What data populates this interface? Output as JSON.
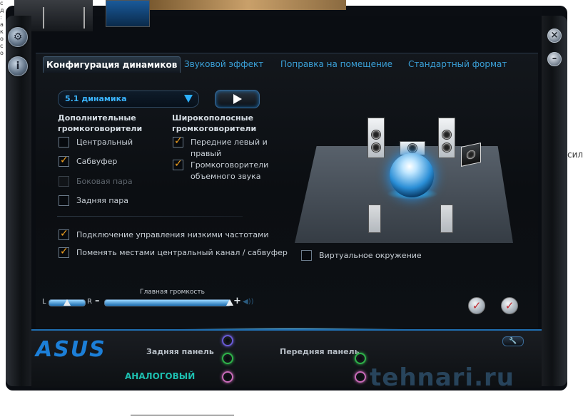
{
  "tabs": [
    {
      "label": "Конфигурация динамиков",
      "active": true
    },
    {
      "label": "Звуковой эффект",
      "active": false
    },
    {
      "label": "Поправка на помещение",
      "active": false
    },
    {
      "label": "Стандартный формат",
      "active": false
    }
  ],
  "speaker_config": {
    "selected": "5.1 динамика"
  },
  "optional_speakers": {
    "heading_line1": "Дополнительные",
    "heading_line2": "громкоговорители",
    "items": [
      {
        "label": "Центральный",
        "checked": false,
        "enabled": true
      },
      {
        "label": "Сабвуфер",
        "checked": true,
        "enabled": true
      },
      {
        "label": "Боковая пара",
        "checked": false,
        "enabled": false
      },
      {
        "label": "Задняя пара",
        "checked": false,
        "enabled": true
      }
    ]
  },
  "fullrange_speakers": {
    "heading_line1": "Широкополосные",
    "heading_line2": "громкоговорители",
    "items": [
      {
        "label_line1": "Передние левый и",
        "label_line2": "правый",
        "checked": true
      },
      {
        "label_line1": "Громкоговорители",
        "label_line2": "объемного звука",
        "checked": true
      }
    ]
  },
  "options": [
    {
      "label": "Подключение управления низкими частотами",
      "checked": true
    },
    {
      "label": "Поменять местами центральный канал / сабвуфер",
      "checked": true
    }
  ],
  "virtual_surround": {
    "label": "Виртуальное окружение",
    "checked": false
  },
  "volume": {
    "title": "Главная громкость",
    "left": "L",
    "right": "R",
    "minus": "–",
    "plus": "+",
    "balance_level": 0.5,
    "main_level": 1.0
  },
  "bottom": {
    "brand": "ASUS",
    "rear_panel": "Задняя панель",
    "front_panel": "Передняя панель",
    "analog": "АНАЛОГОВЫЙ",
    "jack_colors": {
      "rear": [
        "#6a5bd6",
        "#2fb34a",
        "#c86ab8"
      ],
      "front": [
        "#2fb34a",
        "#c86ab8"
      ]
    }
  },
  "watermark": "tehnari.ru",
  "page_fragments": {
    "right_text": "сил"
  },
  "colors": {
    "accent": "#2bb0ff",
    "tab_inactive": "#3aa0d8",
    "checkmark": "#f0a020",
    "analog_text": "#1dbfb0",
    "brand": "#1c7fd8"
  }
}
